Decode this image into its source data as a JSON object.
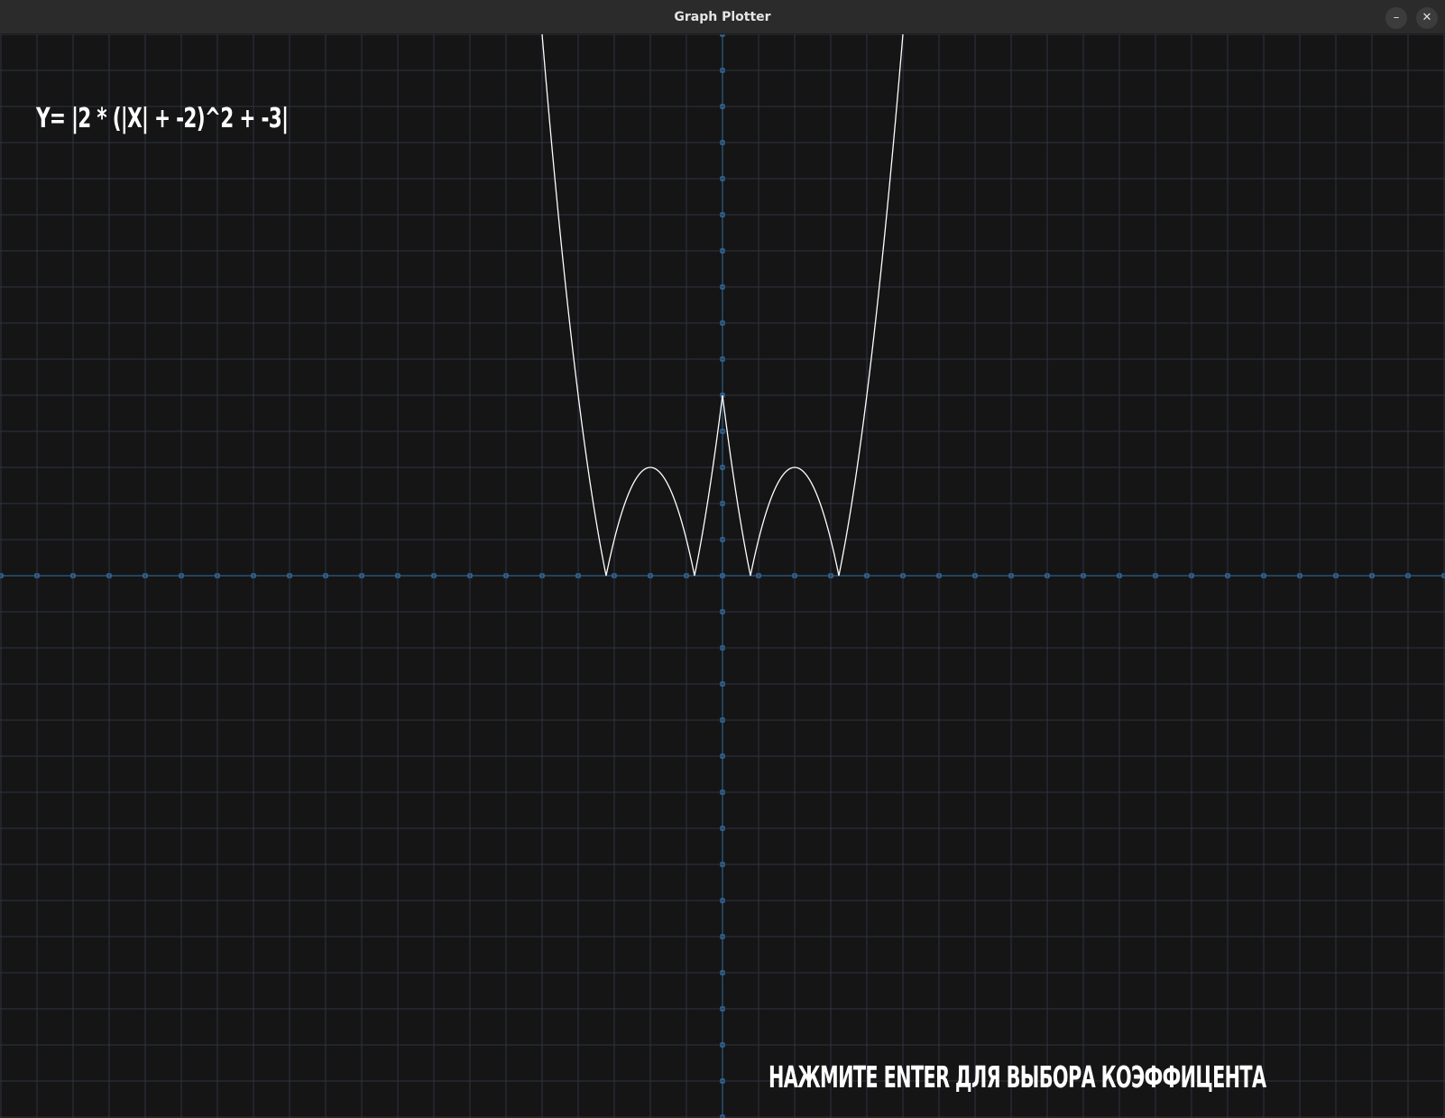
{
  "window": {
    "title": "Graph Plotter",
    "minimize_label": "–",
    "close_label": "✕",
    "minimize_icon": "minimize-icon",
    "close_icon": "close-icon"
  },
  "formula_text": "Y= |2 * (|X| + -2)^2 + -3|",
  "hint_text": "НАЖМИТЕ ENTER ДЛЯ ВЫБОРА КОЭФФИЦЕНТА",
  "colors": {
    "background": "#151516",
    "grid": "#2f3440",
    "axis": "#2d5d86",
    "tick": "#3b7fbf",
    "curve": "#ffffff",
    "titlebar": "#2b2b2b"
  },
  "chart_data": {
    "type": "line",
    "function": "y = |2 * (|x| + -2)^2 + -3|",
    "coefficients": {
      "a": 2,
      "b": -2,
      "c": -3
    },
    "xlim": [
      -20,
      20
    ],
    "ylim": [
      -15,
      15
    ],
    "grid": true,
    "series": [
      {
        "x": [
          -5.0,
          -4.5,
          -4.0,
          -3.5,
          -3.22,
          -3.0,
          -2.5,
          -2.0,
          -1.5,
          -1.0,
          -0.78,
          -0.5,
          0.0,
          0.5,
          0.78,
          1.0,
          1.5,
          2.0,
          2.5,
          3.0,
          3.22,
          3.5,
          4.0,
          4.5,
          5.0
        ],
        "y": [
          15.0,
          9.5,
          5.0,
          1.5,
          0.0,
          1.0,
          2.5,
          3.0,
          2.5,
          1.0,
          0.0,
          1.5,
          5.0,
          1.5,
          0.0,
          1.0,
          2.5,
          3.0,
          2.5,
          1.0,
          0.0,
          1.5,
          5.0,
          9.5,
          15.0
        ]
      }
    ]
  }
}
